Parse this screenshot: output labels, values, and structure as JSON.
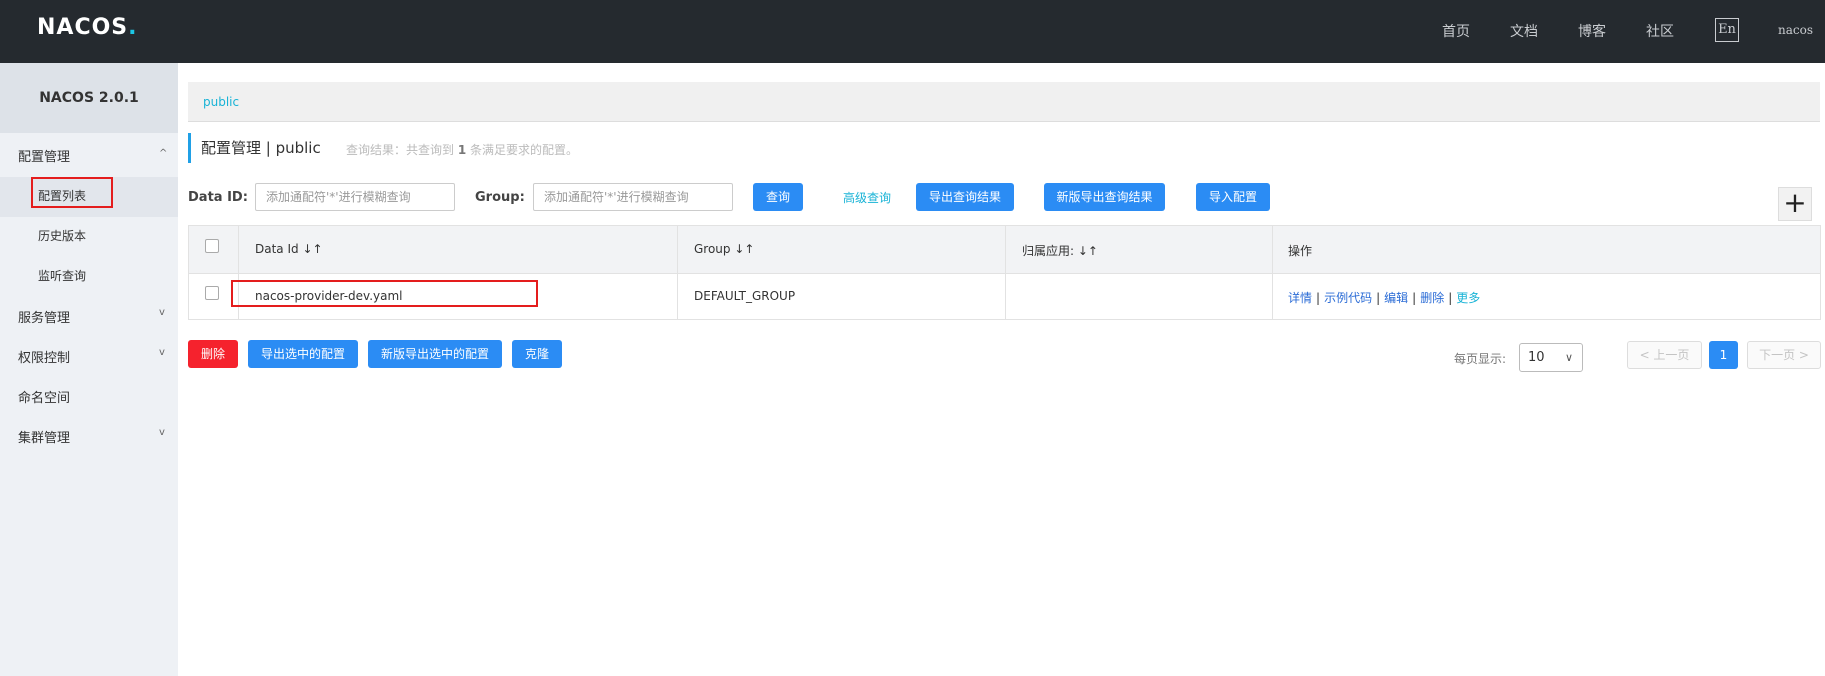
{
  "header": {
    "logo_main": "NAC",
    "logo_o": "OS",
    "logo_dot": ".",
    "nav": [
      "首页",
      "文档",
      "博客",
      "社区"
    ],
    "lang": "En",
    "user": "nacos"
  },
  "sidebar": {
    "title": "NACOS 2.0.1",
    "groups": [
      {
        "label": "配置管理",
        "caret": "^"
      },
      {
        "label": "配置列表"
      },
      {
        "label": "历史版本"
      },
      {
        "label": "监听查询"
      },
      {
        "label": "服务管理",
        "caret": "v"
      },
      {
        "label": "权限控制",
        "caret": "v"
      },
      {
        "label": "命名空间"
      },
      {
        "label": "集群管理",
        "caret": "v"
      }
    ]
  },
  "breadcrumb": "public",
  "page": {
    "title": "配置管理  |  public",
    "result_prefix": "查询结果：共查询到",
    "result_count": "1",
    "result_suffix": "条满足要求的配置。"
  },
  "search": {
    "dataid_label": "Data ID:",
    "dataid_placeholder": "添加通配符'*'进行模糊查询",
    "group_label": "Group:",
    "group_placeholder": "添加通配符'*'进行模糊查询",
    "query_btn": "查询",
    "advanced_link": "高级查询",
    "export_btn": "导出查询结果",
    "export_new_btn": "新版导出查询结果",
    "import_btn": "导入配置",
    "add_icon": "+"
  },
  "table": {
    "headers": [
      "Data Id",
      "Group",
      "归属应用:",
      "操作"
    ],
    "sort_icon": "↓↑",
    "rows": [
      {
        "dataid": "nacos-provider-dev.yaml",
        "group": "DEFAULT_GROUP",
        "app": "",
        "ops": [
          "详情",
          "示例代码",
          "编辑",
          "删除"
        ],
        "more": "更多"
      }
    ]
  },
  "footer": {
    "delete_btn": "删除",
    "export_sel_btn": "导出选中的配置",
    "export_sel_new_btn": "新版导出选中的配置",
    "clone_btn": "克隆",
    "page_size_label": "每页显示:",
    "page_size": "10",
    "prev": "< 上一页",
    "page": "1",
    "next": "下一页 >"
  }
}
